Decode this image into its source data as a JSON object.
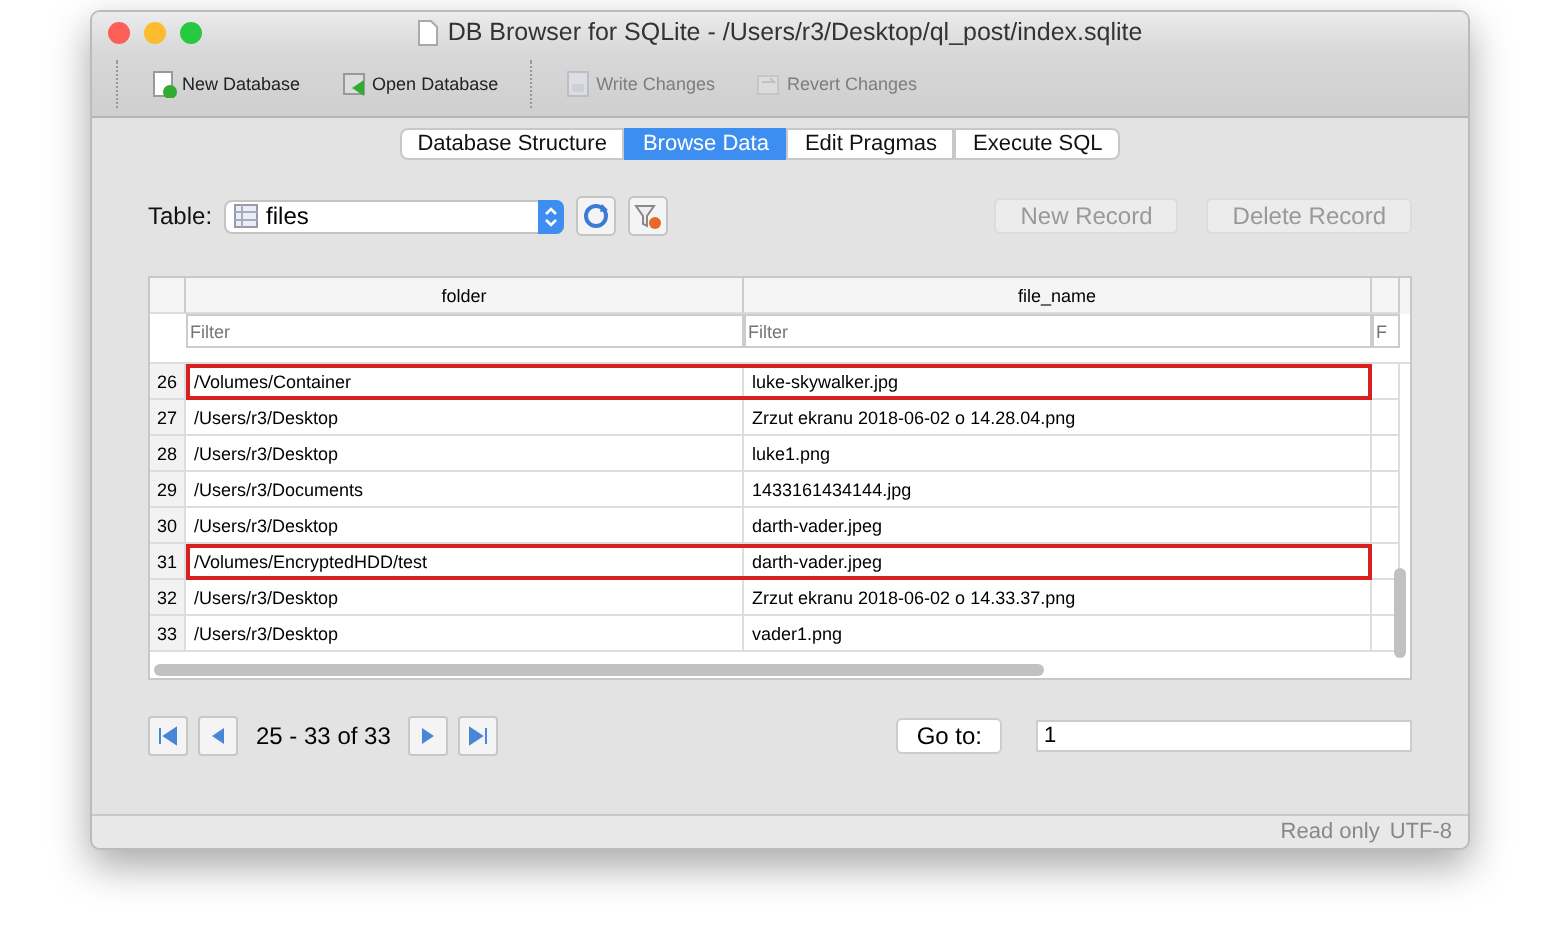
{
  "window": {
    "title": "DB Browser for SQLite - /Users/r3/Desktop/ql_post/index.sqlite"
  },
  "toolbar": [
    {
      "label": "New Database",
      "disabled": false,
      "kind": "new"
    },
    {
      "label": "Open Database",
      "disabled": false,
      "kind": "open"
    },
    {
      "label": "Write Changes",
      "disabled": true,
      "kind": "write"
    },
    {
      "label": "Revert Changes",
      "disabled": true,
      "kind": "revert"
    }
  ],
  "tabs": [
    {
      "label": "Database Structure",
      "selected": false
    },
    {
      "label": "Browse Data",
      "selected": true
    },
    {
      "label": "Edit Pragmas",
      "selected": false
    },
    {
      "label": "Execute SQL",
      "selected": false
    }
  ],
  "table_picker": {
    "label": "Table:",
    "value": "files"
  },
  "record_buttons": [
    {
      "label": "New Record",
      "disabled": true
    },
    {
      "label": "Delete Record",
      "disabled": true
    }
  ],
  "grid": {
    "columns": [
      {
        "name": "folder",
        "filter_placeholder": "Filter"
      },
      {
        "name": "file_name",
        "filter_placeholder": "Filter"
      },
      {
        "filter_placeholder": "F"
      }
    ],
    "rows": [
      {
        "number": "26",
        "cells": [
          "/Volumes/Container",
          "luke-skywalker.jpg"
        ],
        "highlighted": true
      },
      {
        "number": "27",
        "cells": [
          "/Users/r3/Desktop",
          "Zrzut ekranu 2018-06-02 o 14.28.04.png"
        ],
        "highlighted": false
      },
      {
        "number": "28",
        "cells": [
          "/Users/r3/Desktop",
          "luke1.png"
        ],
        "highlighted": false
      },
      {
        "number": "29",
        "cells": [
          "/Users/r3/Documents",
          "1433161434144.jpg"
        ],
        "highlighted": false
      },
      {
        "number": "30",
        "cells": [
          "/Users/r3/Desktop",
          "darth-vader.jpeg"
        ],
        "highlighted": false
      },
      {
        "number": "31",
        "cells": [
          "/Volumes/EncryptedHDD/test",
          "darth-vader.jpeg"
        ],
        "highlighted": true
      },
      {
        "number": "32",
        "cells": [
          "/Users/r3/Desktop",
          "Zrzut ekranu 2018-06-02 o 14.33.37.png"
        ],
        "highlighted": false
      },
      {
        "number": "33",
        "cells": [
          "/Users/r3/Desktop",
          "vader1.png"
        ],
        "highlighted": false
      }
    ]
  },
  "pagination": {
    "range": "25 - 33 of 33",
    "goto_label": "Go to:",
    "goto_value": "1"
  },
  "status_bar": {
    "mode": "Read only",
    "encoding": "UTF-8"
  }
}
